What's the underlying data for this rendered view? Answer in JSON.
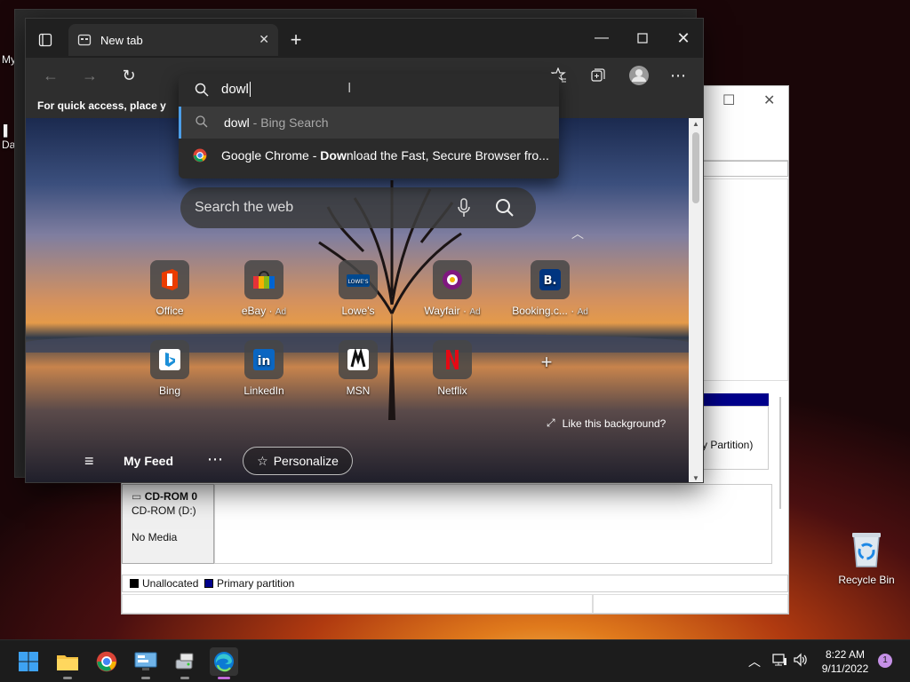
{
  "desktop": {
    "labels": [
      "My",
      "Da"
    ],
    "recycle_bin": "Recycle Bin"
  },
  "disk_mgmt": {
    "cdrom_title": "CD-ROM 0",
    "cdrom_drive": "CD-ROM (D:)",
    "cdrom_media": "No Media",
    "partition_fragment": "y Partition)",
    "legend_unallocated": "Unallocated",
    "legend_primary": "Primary partition",
    "colors": {
      "unallocated": "#000000",
      "primary": "#00008b"
    }
  },
  "browser": {
    "tab_title": "New tab",
    "favorites_hint": "For quick access, place y",
    "omnibox": {
      "query": "dowl",
      "suggestions": [
        {
          "bold": "dowl",
          "rest": " - Bing Search",
          "icon": "search-icon"
        },
        {
          "pre": "Google Chrome - ",
          "bold": "Dow",
          "rest": "nload the Fast, Secure Browser fro...",
          "icon": "chrome-icon"
        }
      ]
    },
    "ntp": {
      "search_placeholder": "Search the web",
      "tiles": [
        {
          "label": "Office",
          "ad": ""
        },
        {
          "label": "eBay",
          "ad": "Ad"
        },
        {
          "label": "Lowe's",
          "ad": ""
        },
        {
          "label": "Wayfair",
          "ad": "Ad"
        },
        {
          "label": "Booking.c...",
          "ad": "Ad"
        },
        {
          "label": "Bing",
          "ad": ""
        },
        {
          "label": "LinkedIn",
          "ad": ""
        },
        {
          "label": "MSN",
          "ad": ""
        },
        {
          "label": "Netflix",
          "ad": ""
        }
      ],
      "like_background": "Like this background?",
      "my_feed": "My Feed",
      "personalize": "Personalize"
    }
  },
  "taskbar": {
    "time": "8:22 AM",
    "date": "9/11/2022",
    "notification_count": "1"
  }
}
